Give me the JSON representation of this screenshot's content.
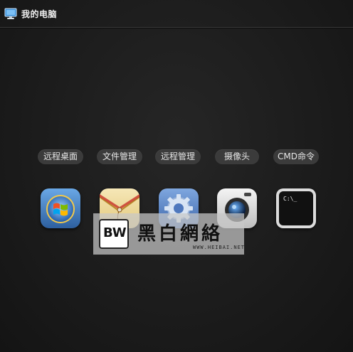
{
  "window": {
    "title": "我的电脑",
    "icon": "computer-icon"
  },
  "actions": [
    {
      "label": "远程桌面"
    },
    {
      "label": "文件管理"
    },
    {
      "label": "远程管理"
    },
    {
      "label": "摄像头"
    },
    {
      "label": "CMD命令"
    }
  ],
  "apps": [
    {
      "icon": "windows-remote-desktop-icon"
    },
    {
      "icon": "file-manager-envelope-icon"
    },
    {
      "icon": "settings-gear-icon"
    },
    {
      "icon": "camera-icon"
    },
    {
      "icon": "terminal-icon",
      "prompt": "C:\\_"
    }
  ],
  "watermark": {
    "logo": "BW",
    "text": "黑白網絡",
    "url": "WWW.HEIBAI.NET"
  },
  "colors": {
    "background": "#1c1c1c",
    "pill": "#3b3b3b",
    "text": "#ffffff"
  }
}
